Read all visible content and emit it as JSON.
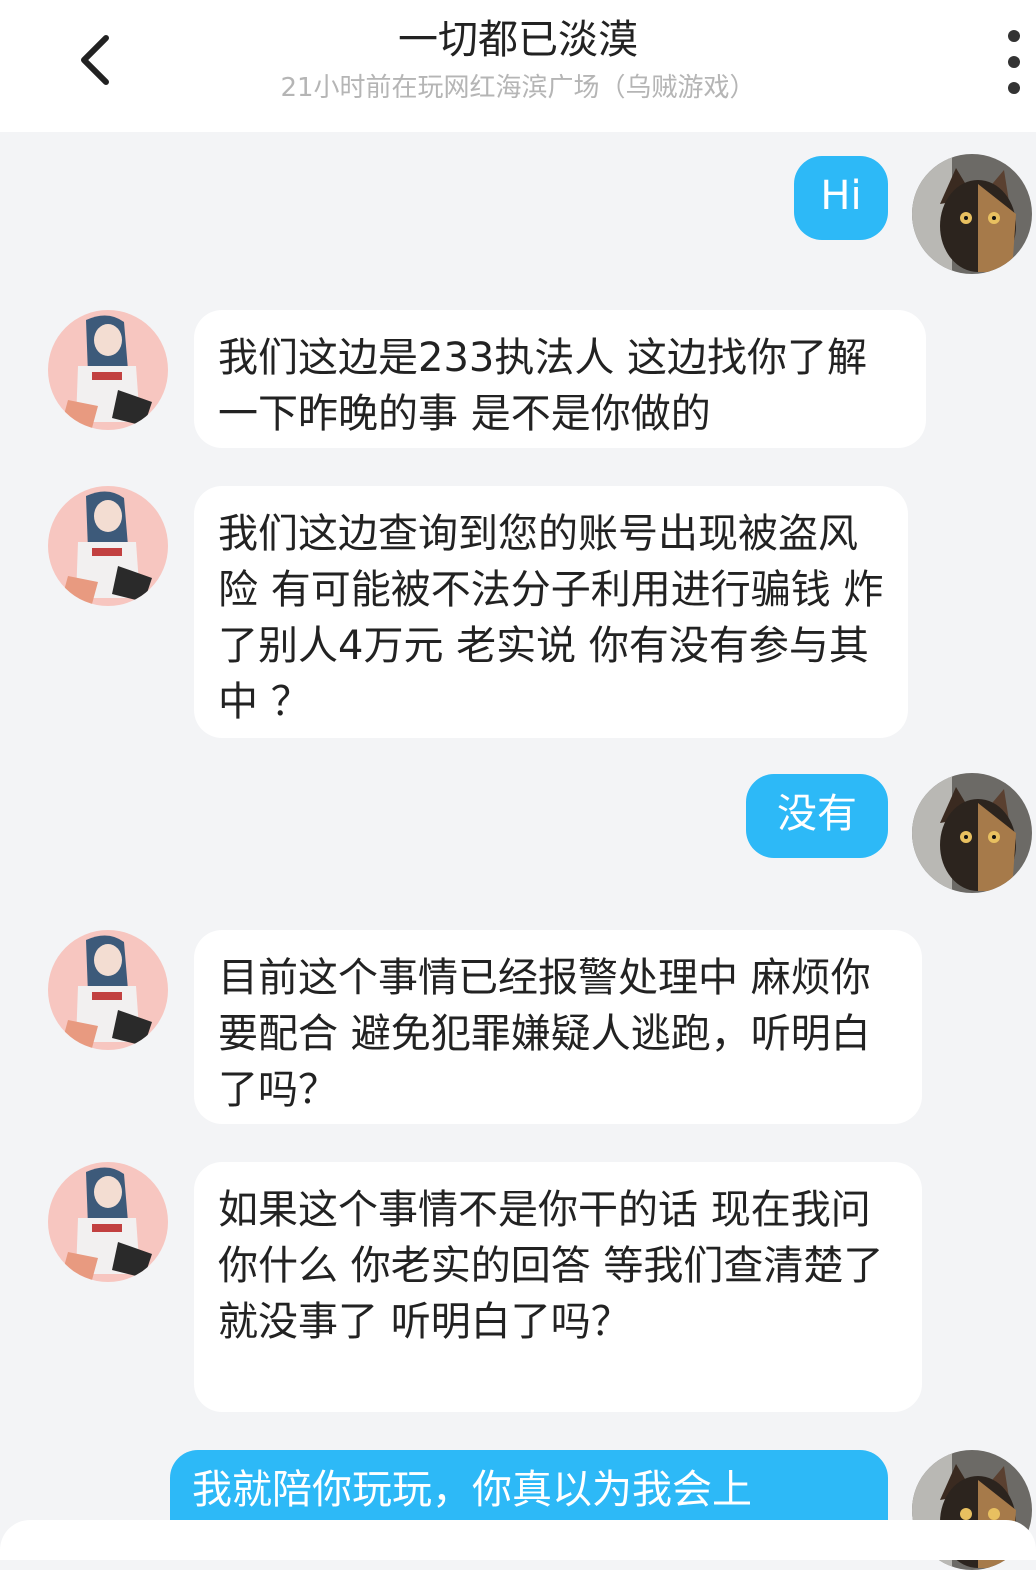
{
  "header": {
    "title": "一切都已淡漠",
    "subtitle": "21小时前在玩网红海滨广场（乌贼游戏）"
  },
  "messages": [
    {
      "from": "self",
      "text": "Hi"
    },
    {
      "from": "other",
      "text": "我们这边是233执法人  这边找你了解一下昨晚的事 是不是你做的"
    },
    {
      "from": "other",
      "text": "我们这边查询到您的账号出现被盗风险  有可能被不法分子利用进行骗钱  炸了别人4万元 老实说 你有没有参与其中 ？"
    },
    {
      "from": "self",
      "text": "没有"
    },
    {
      "from": "other",
      "text": "目前这个事情已经报警处理中 麻烦你要配合 避免犯罪嫌疑人逃跑，听明白了吗？"
    },
    {
      "from": "other",
      "text": "如果这个事情不是你干的话 现在我问你什么 你老实的回答 等我们查清楚了就没事了 听明白了吗？"
    },
    {
      "from": "self",
      "text": "我就陪你玩玩，你真以为我会上"
    }
  ],
  "colors": {
    "self_bubble": "#2db9f7",
    "other_bubble": "#ffffff",
    "background": "#f3f4f6"
  },
  "icons": {
    "back": "chevron-left-icon",
    "more": "more-vertical-icon"
  }
}
